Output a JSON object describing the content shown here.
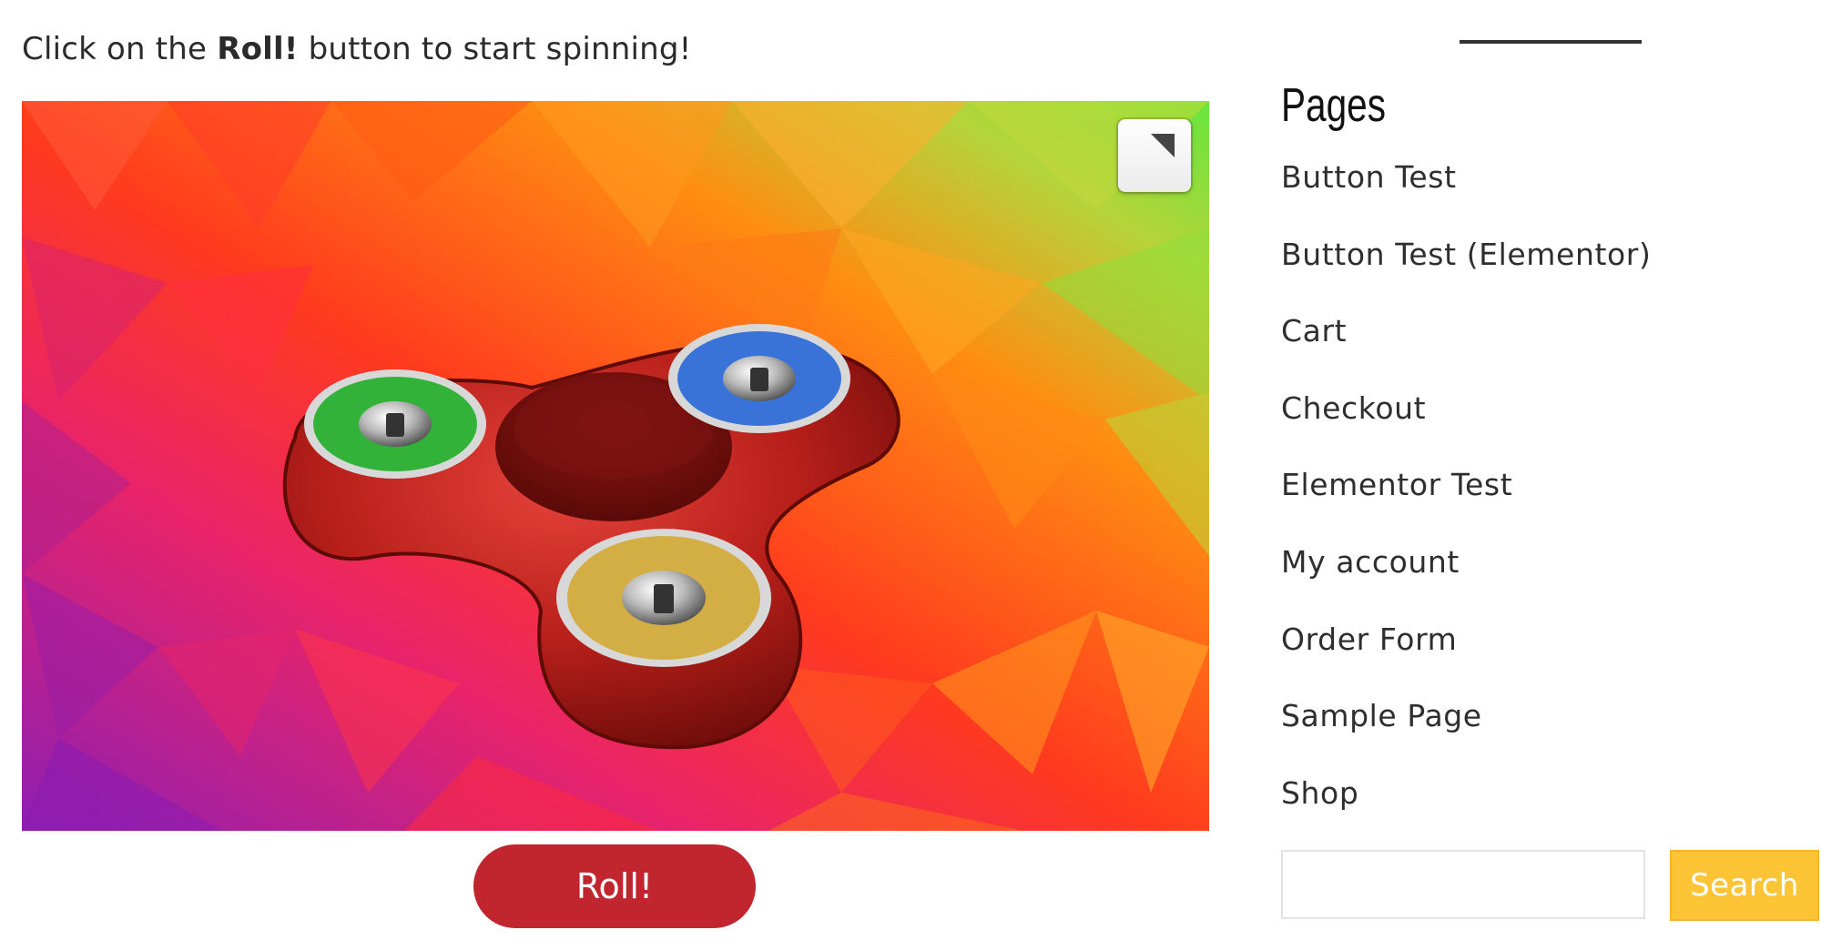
{
  "instruction": {
    "before": "Click on the",
    "emphasis": "Roll!",
    "after": "button to start spinning!"
  },
  "game": {
    "roll_label": "Roll!",
    "spinner_body_color": "#b8201c",
    "bearing_colors": {
      "left": "#33b23a",
      "right": "#3a73d8",
      "bottom": "#d3ae45"
    },
    "background_palette": [
      "#9a1fb0",
      "#e4266c",
      "#ff3a1e",
      "#ff8a10",
      "#6ae43c"
    ]
  },
  "sidebar": {
    "widget_title": "Pages",
    "pages": [
      {
        "label": "Button Test"
      },
      {
        "label": "Button Test (Elementor)"
      },
      {
        "label": "Cart"
      },
      {
        "label": "Checkout"
      },
      {
        "label": "Elementor Test"
      },
      {
        "label": "My account"
      },
      {
        "label": "Order Form"
      },
      {
        "label": "Sample Page"
      },
      {
        "label": "Shop"
      }
    ],
    "search": {
      "placeholder": "",
      "button_label": "Search"
    },
    "accent_color": "#fdc536"
  }
}
